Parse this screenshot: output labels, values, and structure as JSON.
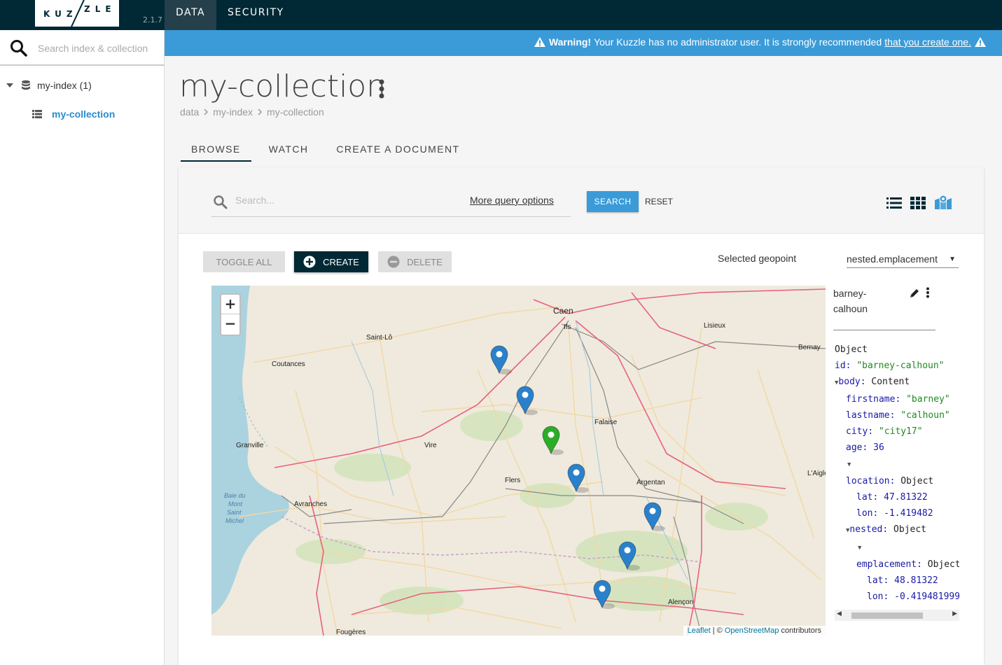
{
  "app": {
    "logo_left": "KUZ",
    "logo_right": "ZLE",
    "version": "2.1.7",
    "nav": [
      {
        "label": "DATA"
      },
      {
        "label": "SECURITY"
      }
    ]
  },
  "sidebar": {
    "search_placeholder": "Search index & collection",
    "index_label": "my-index (1)",
    "collection_label": "my-collection"
  },
  "warning": {
    "bold": "Warning!",
    "text": "Your Kuzzle has no administrator user. It is strongly recommended",
    "link": "that you create one."
  },
  "page": {
    "title": "my-collection",
    "breadcrumb": [
      "data",
      "my-index",
      "my-collection"
    ],
    "tabs": [
      {
        "label": "BROWSE"
      },
      {
        "label": "WATCH"
      },
      {
        "label": "CREATE A DOCUMENT"
      }
    ]
  },
  "toolbar": {
    "search_placeholder": "Search...",
    "more_query": "More query options",
    "search_label": "SEARCH",
    "reset_label": "RESET",
    "toggle_all": "TOGGLE ALL",
    "create": "CREATE",
    "delete": "DELETE",
    "geopoint_label": "Selected geopoint",
    "geopoint_value": "nested.emplacement"
  },
  "map": {
    "zoom_in": "+",
    "zoom_out": "−",
    "attribution_leaflet": "Leaflet",
    "attribution_sep": " | © ",
    "attribution_osm": "OpenStreetMap",
    "attribution_tail": " contributors",
    "places": [
      "Caen",
      "Ifs",
      "Lisieux",
      "Saint-Lô",
      "Bernay",
      "Coutances",
      "Falaise",
      "Granville",
      "Vire",
      "Flers",
      "Argentan",
      "L'Aigle",
      "Avranches",
      "Baie du Mont Saint Michel",
      "Alençon",
      "Fougères"
    ],
    "markers": [
      {
        "color": "blue"
      },
      {
        "color": "blue"
      },
      {
        "color": "green"
      },
      {
        "color": "blue"
      },
      {
        "color": "blue"
      },
      {
        "color": "blue"
      },
      {
        "color": "blue"
      }
    ]
  },
  "document": {
    "name": "barney-calhoun",
    "lines": [
      {
        "k": "",
        "v": "Object",
        "vt": "t"
      },
      {
        "k": "id",
        "v": "\"barney-calhoun\"",
        "vt": "s"
      },
      {
        "k": "body",
        "v": "Content",
        "vt": "t"
      },
      {
        "k": "firstname",
        "v": "\"barney\"",
        "vt": "s"
      },
      {
        "k": "lastname",
        "v": "\"calhoun\"",
        "vt": "s"
      },
      {
        "k": "city",
        "v": "\"city17\"",
        "vt": "s"
      },
      {
        "k": "age",
        "v": "36",
        "vt": "n"
      },
      {
        "k": "location",
        "v": "Object",
        "vt": "t"
      },
      {
        "k": "lat",
        "v": "47.81322",
        "vt": "n"
      },
      {
        "k": "lon",
        "v": "-1.419482",
        "vt": "n"
      },
      {
        "k": "nested",
        "v": "Object",
        "vt": "t"
      },
      {
        "k": "emplacement",
        "v": "Object",
        "vt": "t"
      },
      {
        "k": "lat",
        "v": "48.81322",
        "vt": "n"
      },
      {
        "k": "lon",
        "v": "-0.419481999",
        "vt": "n"
      }
    ]
  },
  "colors": {
    "topbar": "#002835",
    "warning": "#3a9bd8",
    "accent": "#2a8bd0",
    "marker_blue": "#2a81cb",
    "marker_green": "#2aad27"
  }
}
